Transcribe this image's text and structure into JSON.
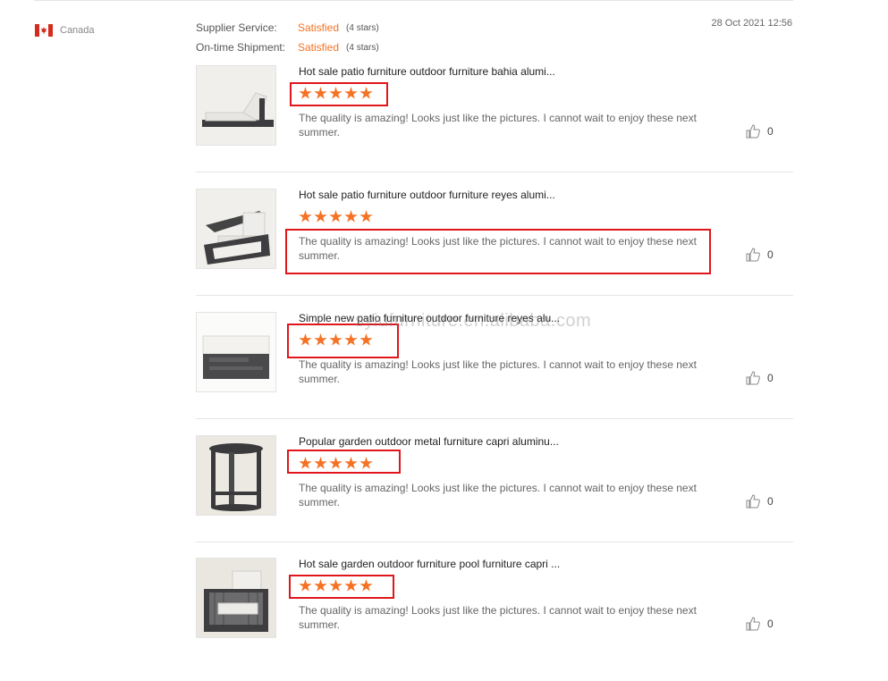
{
  "reviewer": {
    "country": "Canada"
  },
  "ratings": [
    {
      "label": "Supplier Service:",
      "value": "Satisfied",
      "stars": "(4 stars)"
    },
    {
      "label": "On-time Shipment:",
      "value": "Satisfied",
      "stars": "(4 stars)"
    }
  ],
  "date": "28 Oct 2021 12:56",
  "watermark": "syiufurniture.en.alibaba.com",
  "reviews": [
    {
      "title": "Hot sale patio furniture outdoor furniture bahia alumi...",
      "rating": 5,
      "text": "The quality is amazing!  Looks just like the pictures. I cannot wait to enjoy these next summer.",
      "likes": "0",
      "image": "lounger"
    },
    {
      "title": "Hot sale patio furniture outdoor furniture reyes alumi...",
      "rating": 5,
      "text": "The quality is amazing!  Looks just like the pictures. I cannot wait to enjoy these next summer.",
      "likes": "0",
      "image": "armchair"
    },
    {
      "title": "Simple new patio furniture outdoor furniture reyes alu...",
      "rating": 5,
      "text": "The quality is amazing!  Looks just like the pictures. I cannot wait to enjoy these next summer.",
      "likes": "0",
      "image": "ottoman"
    },
    {
      "title": "Popular garden outdoor metal furniture capri aluminu...",
      "rating": 5,
      "text": "The quality is amazing!  Looks just like the pictures. I cannot wait to enjoy these next summer.",
      "likes": "0",
      "image": "side-table"
    },
    {
      "title": "Hot sale garden outdoor furniture pool furniture capri ...",
      "rating": 5,
      "text": "The quality is amazing!  Looks just like the pictures. I cannot wait to enjoy these next summer.",
      "likes": "0",
      "image": "rope-chair"
    }
  ],
  "colors": {
    "accent": "#f57224",
    "highlight": "#e0161b"
  }
}
